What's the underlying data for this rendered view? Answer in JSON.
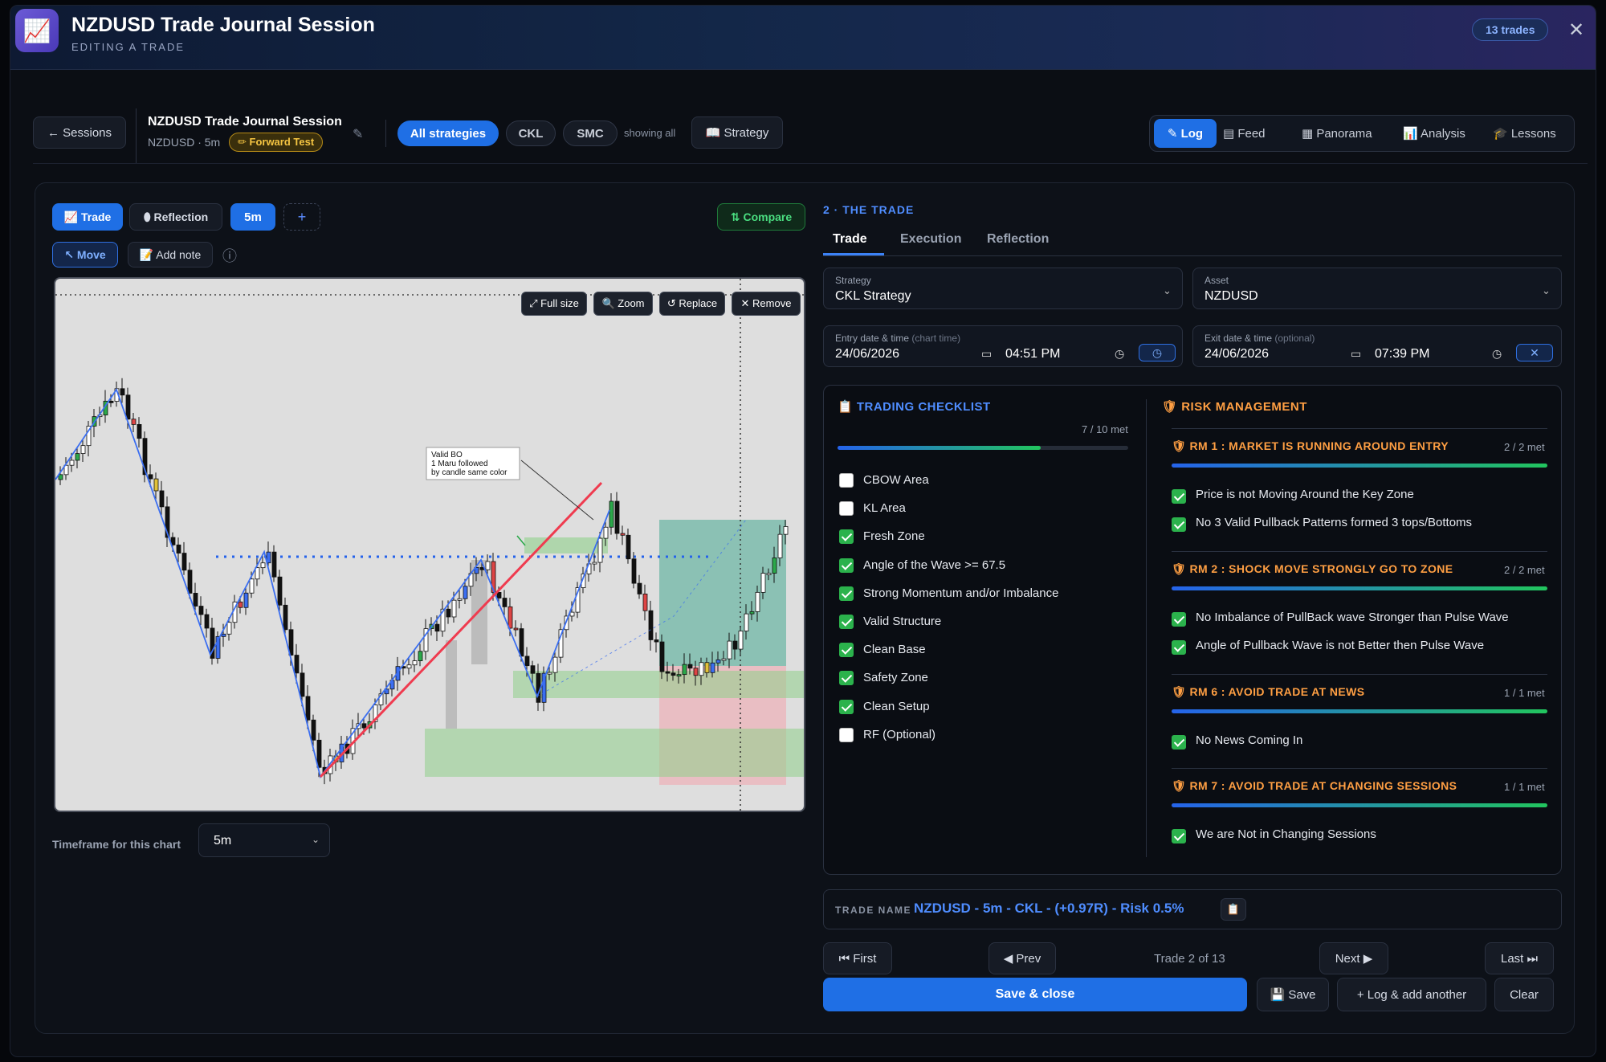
{
  "header": {
    "title": "NZDUSD Trade Journal Session",
    "subtitle": "EDITING A TRADE",
    "trade_count": "13 trades",
    "logo_icon": "chart-icon"
  },
  "topbar": {
    "back_label": "← Sessions",
    "session_title": "NZDUSD Trade Journal Session",
    "session_meta": "NZDUSD · 5m",
    "forward_badge": "✏ Forward Test",
    "strategies": [
      "All strategies",
      "CKL",
      "SMC"
    ],
    "showing": "showing all",
    "strategy_btn": "📖 Strategy",
    "views": [
      "✎ Log",
      "▤ Feed",
      "▦ Panorama",
      "📊 Analysis",
      "🎓 Lessons"
    ]
  },
  "chart_panel": {
    "tabs": [
      "📈 Trade",
      "⬮ Reflection",
      "5m",
      "+"
    ],
    "compare": "⇅ Compare",
    "tools": [
      "↖ Move",
      "📝 Add note"
    ],
    "info_icon": "ⓘ",
    "overlay_buttons": [
      "⤢ Full size",
      "🔍 Zoom",
      "↺ Replace",
      "✕ Remove"
    ],
    "annotation": [
      "Valid BO",
      "1 Maru followed",
      "by candle same color"
    ],
    "timeframe_label": "Timeframe for this chart",
    "timeframe_value": "5m"
  },
  "form": {
    "section": "2 · THE TRADE",
    "tabs": [
      "Trade",
      "Execution",
      "Reflection"
    ],
    "strategy_label": "Strategy",
    "strategy_value": "CKL Strategy",
    "asset_label": "Asset",
    "asset_value": "NZDUSD",
    "entry_label": "Entry date & time",
    "entry_hint": "(chart time)",
    "entry_date": "24/06/2026",
    "entry_time": "04:51 PM",
    "exit_label": "Exit date & time",
    "exit_hint": "(optional)",
    "exit_date": "24/06/2026",
    "exit_time": "07:39 PM"
  },
  "checklist": {
    "title": "📋 TRADING CHECKLIST",
    "met": "7 / 10 met",
    "progress": 0.7,
    "items": [
      {
        "label": "CBOW Area",
        "checked": false
      },
      {
        "label": "KL Area",
        "checked": false
      },
      {
        "label": "Fresh Zone",
        "checked": true
      },
      {
        "label": "Angle of the Wave >= 67.5",
        "checked": true
      },
      {
        "label": "Strong Momentum and/or Imbalance",
        "checked": true
      },
      {
        "label": "Valid Structure",
        "checked": true
      },
      {
        "label": "Clean Base",
        "checked": true
      },
      {
        "label": "Safety Zone",
        "checked": true
      },
      {
        "label": "Clean Setup",
        "checked": true
      },
      {
        "label": "RF (Optional)",
        "checked": false
      }
    ]
  },
  "risk": {
    "title": "🛡 RISK MANAGEMENT",
    "groups": [
      {
        "title": "🛡 RM 1 : MARKET IS RUNNING AROUND ENTRY",
        "met": "2 / 2 met",
        "items": [
          "Price is not Moving Around the Key Zone",
          "No 3 Valid Pullback Patterns formed 3 tops/Bottoms"
        ]
      },
      {
        "title": "🛡 RM 2 : SHOCK MOVE STRONGLY GO TO ZONE",
        "met": "2 / 2 met",
        "items": [
          "No Imbalance of PullBack wave Stronger than Pulse Wave",
          "Angle of Pullback Wave is not Better then Pulse Wave"
        ]
      },
      {
        "title": "🛡 RM 6 : AVOID TRADE AT NEWS",
        "met": "1 / 1 met",
        "items": [
          "No News Coming In"
        ]
      },
      {
        "title": "🛡 RM 7 : AVOID TRADE AT CHANGING SESSIONS",
        "met": "1 / 1 met",
        "items": [
          "We are Not in Changing Sessions"
        ]
      }
    ]
  },
  "trade_name": {
    "label": "TRADE NAME",
    "value": "NZDUSD - 5m - CKL - (+0.97R) - Risk 0.5%",
    "copy_icon": "📋"
  },
  "nav": {
    "first": "⏮ First",
    "prev": "◀ Prev",
    "position": "Trade 2 of 13",
    "next": "Next ▶",
    "last": "Last ⏭"
  },
  "actions": {
    "save_close": "Save & close",
    "save": "💾 Save",
    "log_add": "+ Log & add another",
    "clear": "Clear"
  }
}
